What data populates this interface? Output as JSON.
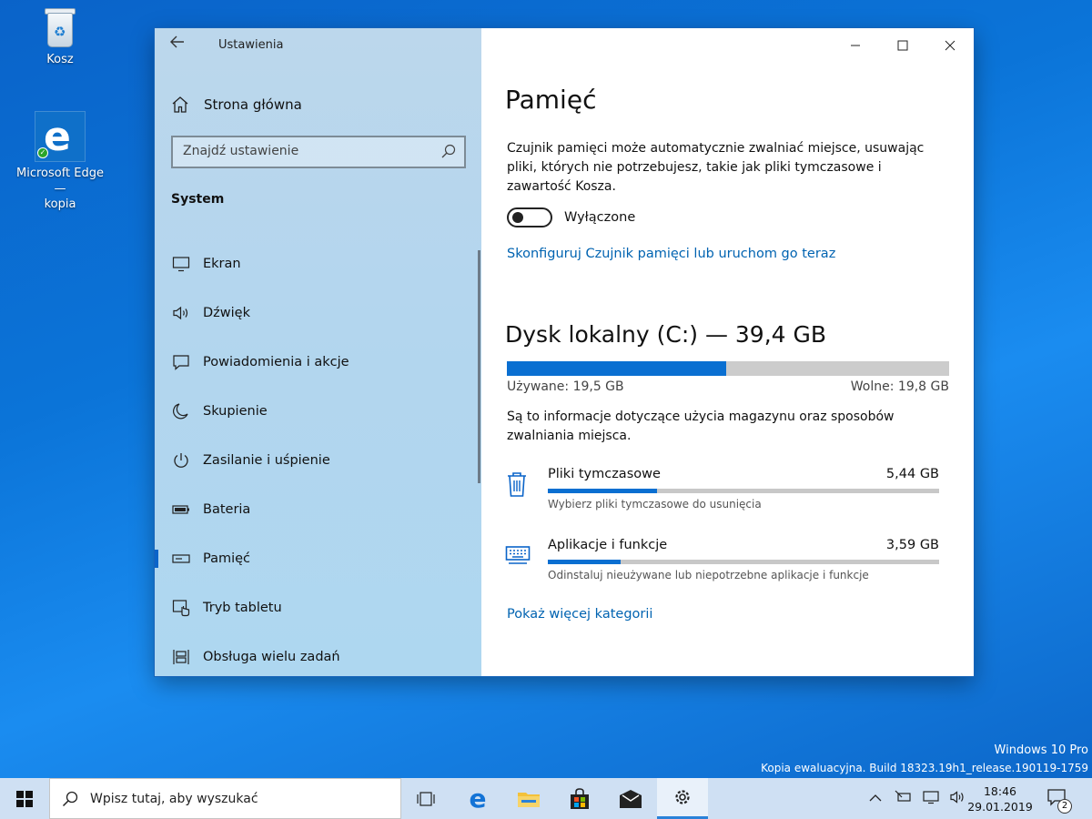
{
  "desktop": {
    "icons": [
      {
        "label": "Kosz",
        "icon": "recycle-bin-icon"
      },
      {
        "label": "Microsoft Edge —\nkopia",
        "icon": "edge-icon"
      }
    ]
  },
  "window": {
    "title": "Ustawienia",
    "home_label": "Strona główna",
    "search_placeholder": "Znajdź ustawienie",
    "section": "System",
    "nav": [
      {
        "label": "Ekran",
        "icon": "display-icon"
      },
      {
        "label": "Dźwięk",
        "icon": "speaker-icon"
      },
      {
        "label": "Powiadomienia i akcje",
        "icon": "notification-icon"
      },
      {
        "label": "Skupienie",
        "icon": "moon-icon"
      },
      {
        "label": "Zasilanie i uśpienie",
        "icon": "power-icon"
      },
      {
        "label": "Bateria",
        "icon": "battery-icon"
      },
      {
        "label": "Pamięć",
        "icon": "storage-icon",
        "active": true
      },
      {
        "label": "Tryb tabletu",
        "icon": "tablet-mode-icon"
      },
      {
        "label": "Obsługa wielu zadań",
        "icon": "multitasking-icon"
      }
    ]
  },
  "content": {
    "title": "Pamięć",
    "description": "Czujnik pamięci może automatycznie zwalniać miejsce, usuwając pliki, których nie potrzebujesz, takie jak pliki tymczasowe i zawartość Kosza.",
    "toggle_label": "Wyłączone",
    "toggle_on": false,
    "configure_link": "Skonfiguruj Czujnik pamięci lub uruchom go teraz",
    "disk": {
      "title": "Dysk lokalny (C:) — 39,4 GB",
      "used_label": "Używane: 19,5 GB",
      "free_label": "Wolne: 19,8 GB",
      "used_fraction": 0.495
    },
    "info": "Są to informacje dotyczące użycia magazynu oraz sposobów zwalniania miejsca.",
    "categories": [
      {
        "name": "Pliki tymczasowe",
        "size": "5,44 GB",
        "sub": "Wybierz pliki tymczasowe do usunięcia",
        "fraction": 0.28,
        "icon": "trash-icon"
      },
      {
        "name": "Aplikacje i funkcje",
        "size": "3,59 GB",
        "sub": "Odinstaluj nieużywane lub niepotrzebne aplikacje i funkcje",
        "fraction": 0.185,
        "icon": "keyboard-icon"
      }
    ],
    "more_link": "Pokaż więcej kategorii"
  },
  "watermark": {
    "line1": "Windows 10 Pro",
    "line2": "Kopia ewaluacyjna. Build 18323.19h1_release.190119-1759"
  },
  "taskbar": {
    "search_placeholder": "Wpisz tutaj, aby wyszukać",
    "time": "18:46",
    "date": "29.01.2019",
    "notification_count": "2",
    "accent": "#2a82d9"
  }
}
